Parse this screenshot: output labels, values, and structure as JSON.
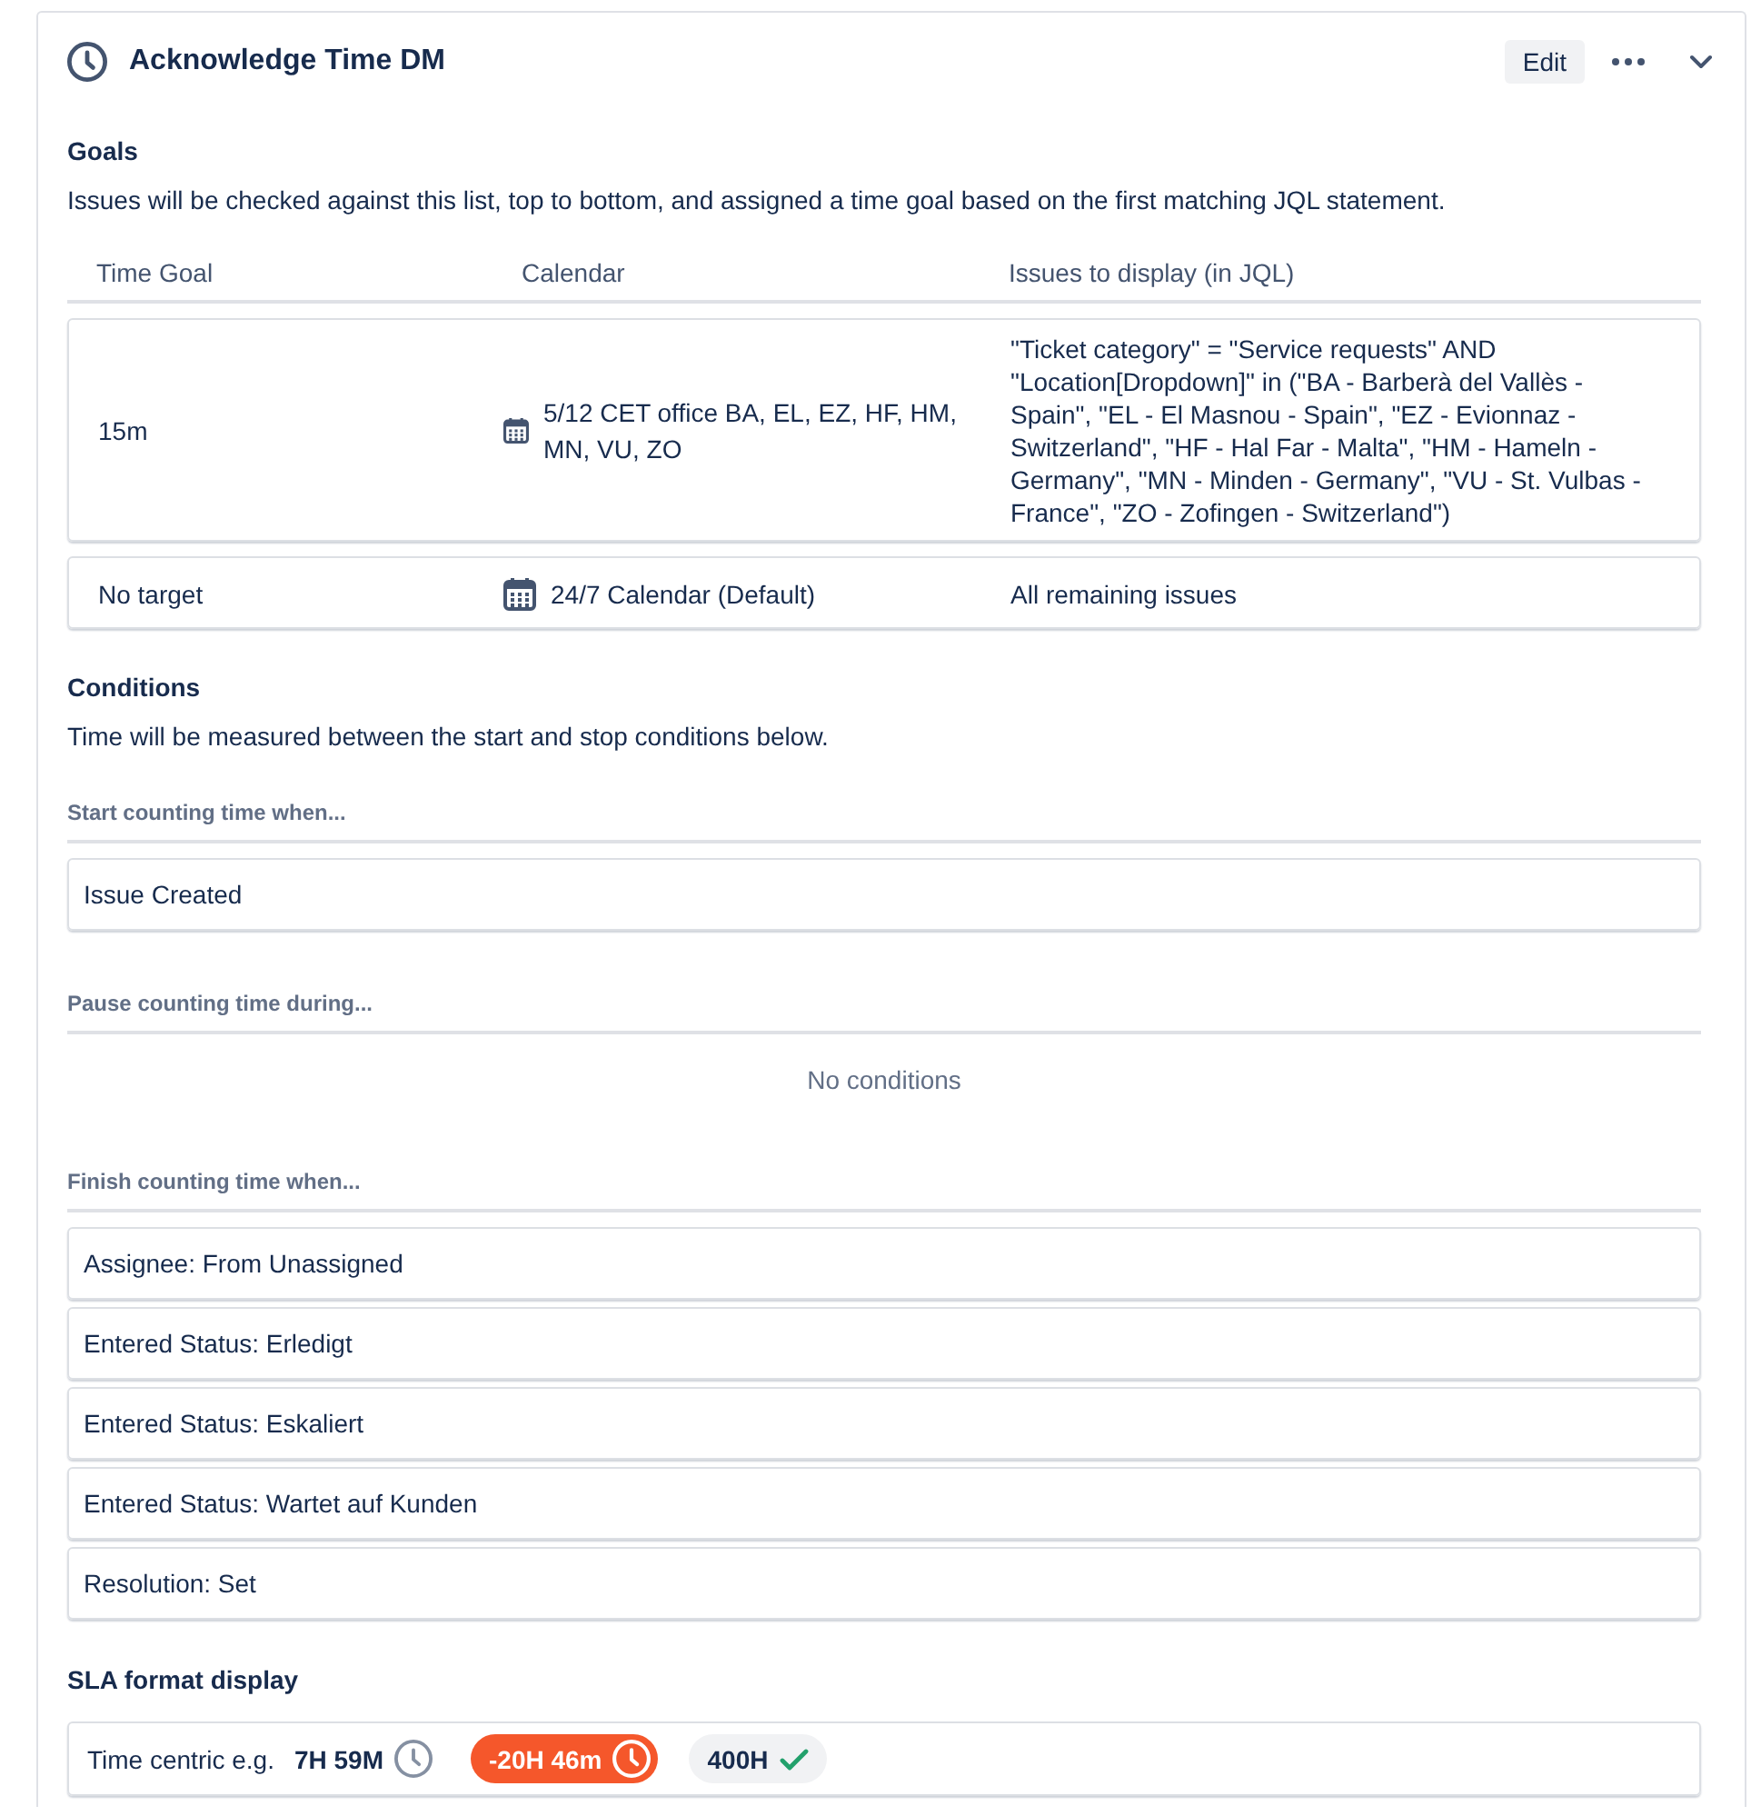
{
  "panel": {
    "title": "Acknowledge Time DM",
    "edit_button": "Edit"
  },
  "goals": {
    "heading": "Goals",
    "description": "Issues will be checked against this list, top to bottom, and assigned a time goal based on the first matching JQL statement.",
    "columns": [
      "Time Goal",
      "Calendar",
      "Issues to display (in JQL)"
    ],
    "rows": [
      {
        "time_goal": "15m",
        "calendar": "5/12 CET office BA, EL, EZ, HF, HM, MN, VU, ZO",
        "jql": "\"Ticket category\" = \"Service requests\" AND \"Location[Dropdown]\" in (\"BA - Barberà del Vallès - Spain\", \"EL - El Masnou - Spain\", \"EZ - Evionnaz - Switzerland\", \"HF - Hal Far - Malta\", \"HM - Hameln - Germany\", \"MN - Minden - Germany\", \"VU - St. Vulbas - France\", \"ZO - Zofingen - Switzerland\")"
      },
      {
        "time_goal": "No target",
        "calendar": "24/7 Calendar (Default)",
        "jql": "All remaining issues"
      }
    ]
  },
  "conditions": {
    "heading": "Conditions",
    "description": "Time will be measured between the start and stop conditions below.",
    "groups": [
      {
        "label": "Start counting time when...",
        "items": [
          "Issue Created"
        ]
      },
      {
        "label": "Pause counting time during...",
        "empty_text": "No conditions"
      },
      {
        "label": "Finish counting time when...",
        "items": [
          "Assignee: From Unassigned",
          "Entered Status: Erledigt",
          "Entered Status: Eskaliert",
          "Entered Status: Wartet auf Kunden",
          "Resolution: Set"
        ]
      }
    ]
  },
  "sla_format": {
    "heading": "SLA format display",
    "label": "Time centric e.g.",
    "examples": [
      {
        "kind": "running",
        "text": "7H 59M"
      },
      {
        "kind": "breached",
        "text": "-20H 46m"
      },
      {
        "kind": "met",
        "text": "400H"
      }
    ]
  }
}
